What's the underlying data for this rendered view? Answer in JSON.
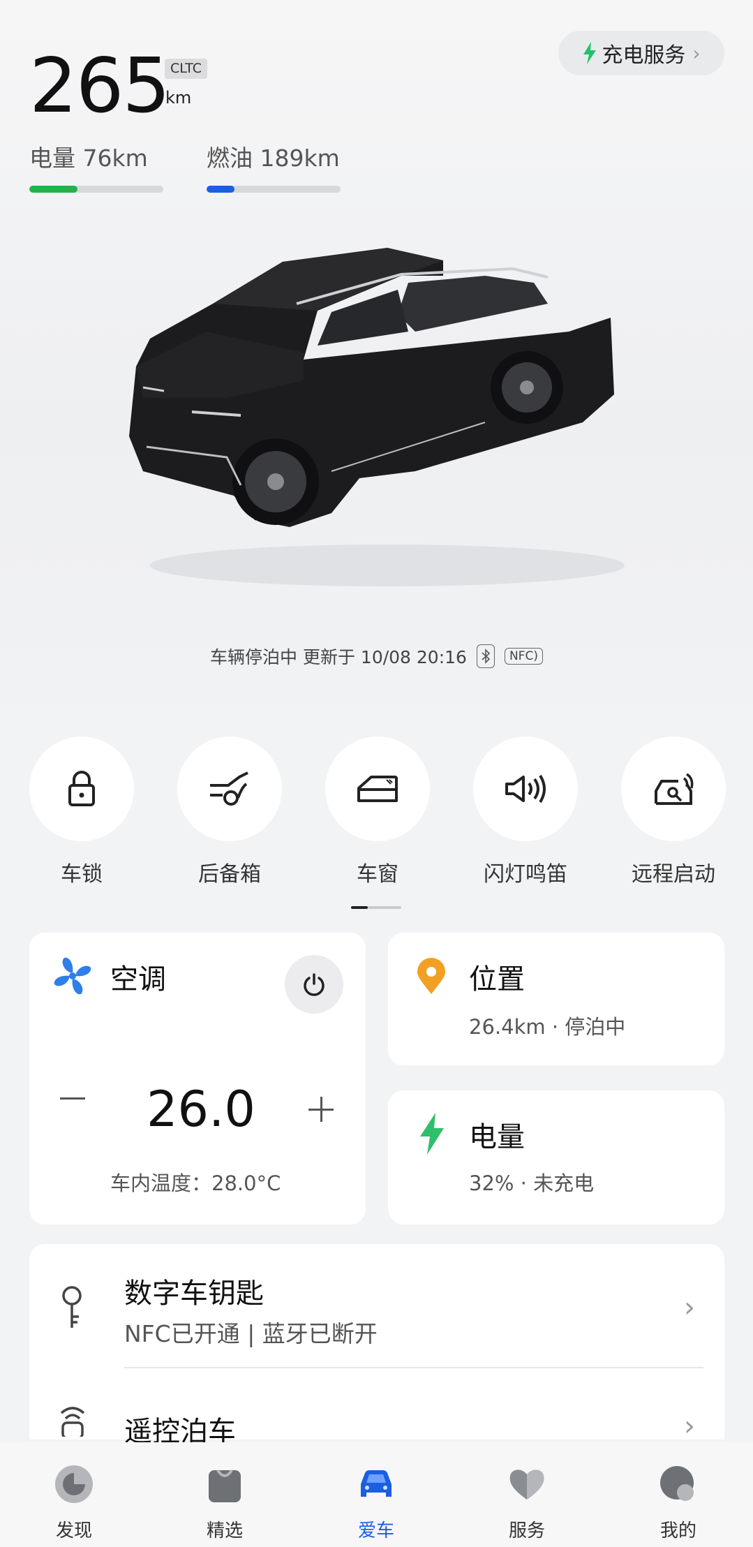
{
  "range": {
    "total": "265",
    "standard_badge": "CLTC",
    "unit": "km",
    "electric_label": "电量 76km",
    "fuel_label": "燃油 189km",
    "electric_fraction": 0.36,
    "fuel_fraction": 0.21,
    "electric_color": "#22b34a",
    "fuel_color": "#1a5fe0"
  },
  "charge_service": {
    "label": "充电服务",
    "icon": "lightning-icon",
    "icon_color": "#22c26a"
  },
  "status": {
    "text": "车辆停泊中 更新于 10/08 20:16",
    "nfc_badge": "NFC"
  },
  "controls": [
    {
      "label": "车锁",
      "icon": "lock-icon"
    },
    {
      "label": "后备箱",
      "icon": "trunk-icon"
    },
    {
      "label": "车窗",
      "icon": "window-icon"
    },
    {
      "label": "闪灯鸣笛",
      "icon": "horn-icon"
    },
    {
      "label": "远程启动",
      "icon": "remote-start-icon"
    }
  ],
  "climate": {
    "title": "空调",
    "temperature": "26.0",
    "cabin_temp": "车内温度：28.0°C",
    "icon": "fan-icon",
    "icon_color": "#2f7fe8"
  },
  "location": {
    "title": "位置",
    "detail": "26.4km · 停泊中",
    "icon": "location-pin-icon",
    "icon_color": "#f2a024"
  },
  "battery": {
    "title": "电量",
    "detail": "32% · 未充电",
    "icon": "lightning-icon",
    "icon_color": "#2fbf6a"
  },
  "digital_key": {
    "title": "数字车钥匙",
    "detail": "NFC已开通 | 蓝牙已断开",
    "icon": "key-icon"
  },
  "remote_parking": {
    "title": "遥控泊车",
    "icon": "remote-parking-icon"
  },
  "tabs": [
    {
      "label": "发现",
      "icon": "discover-icon",
      "active": false
    },
    {
      "label": "精选",
      "icon": "shopping-bag-icon",
      "active": false
    },
    {
      "label": "爱车",
      "icon": "car-icon",
      "active": true
    },
    {
      "label": "服务",
      "icon": "heart-icon",
      "active": false
    },
    {
      "label": "我的",
      "icon": "profile-icon",
      "active": false
    }
  ],
  "accent_color": "#1a5fe0"
}
